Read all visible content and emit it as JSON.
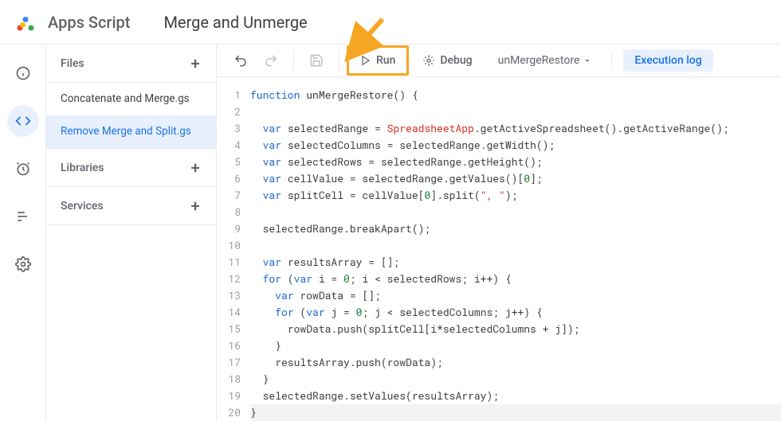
{
  "header": {
    "app_name": "Apps Script",
    "project_name": "Merge and Unmerge"
  },
  "rail": {
    "items": [
      "info",
      "editor",
      "triggers",
      "executions",
      "settings"
    ],
    "active_index": 1
  },
  "files_panel": {
    "files_label": "Files",
    "libraries_label": "Libraries",
    "services_label": "Services",
    "files": [
      {
        "name": "Concatenate and Merge.gs",
        "selected": false
      },
      {
        "name": "Remove Merge and Split.gs",
        "selected": true
      }
    ]
  },
  "toolbar": {
    "run_label": "Run",
    "debug_label": "Debug",
    "function_selected": "unMergeRestore",
    "execution_log_label": "Execution log"
  },
  "editor": {
    "lines": [
      "function unMergeRestore() {",
      "",
      "  var selectedRange = SpreadsheetApp.getActiveSpreadsheet().getActiveRange();",
      "  var selectedColumns = selectedRange.getWidth();",
      "  var selectedRows = selectedRange.getHeight();",
      "  var cellValue = selectedRange.getValues()[0];",
      "  var splitCell = cellValue[0].split(\", \");",
      "",
      "  selectedRange.breakApart();",
      "",
      "  var resultsArray = [];",
      "  for (var i = 0; i < selectedRows; i++) {",
      "    var rowData = [];",
      "    for (var j = 0; j < selectedColumns; j++) {",
      "      rowData.push(splitCell[i*selectedColumns + j]);",
      "    }",
      "    resultsArray.push(rowData);",
      "  }",
      "  selectedRange.setValues(resultsArray);",
      "}"
    ],
    "line_count": 20
  }
}
